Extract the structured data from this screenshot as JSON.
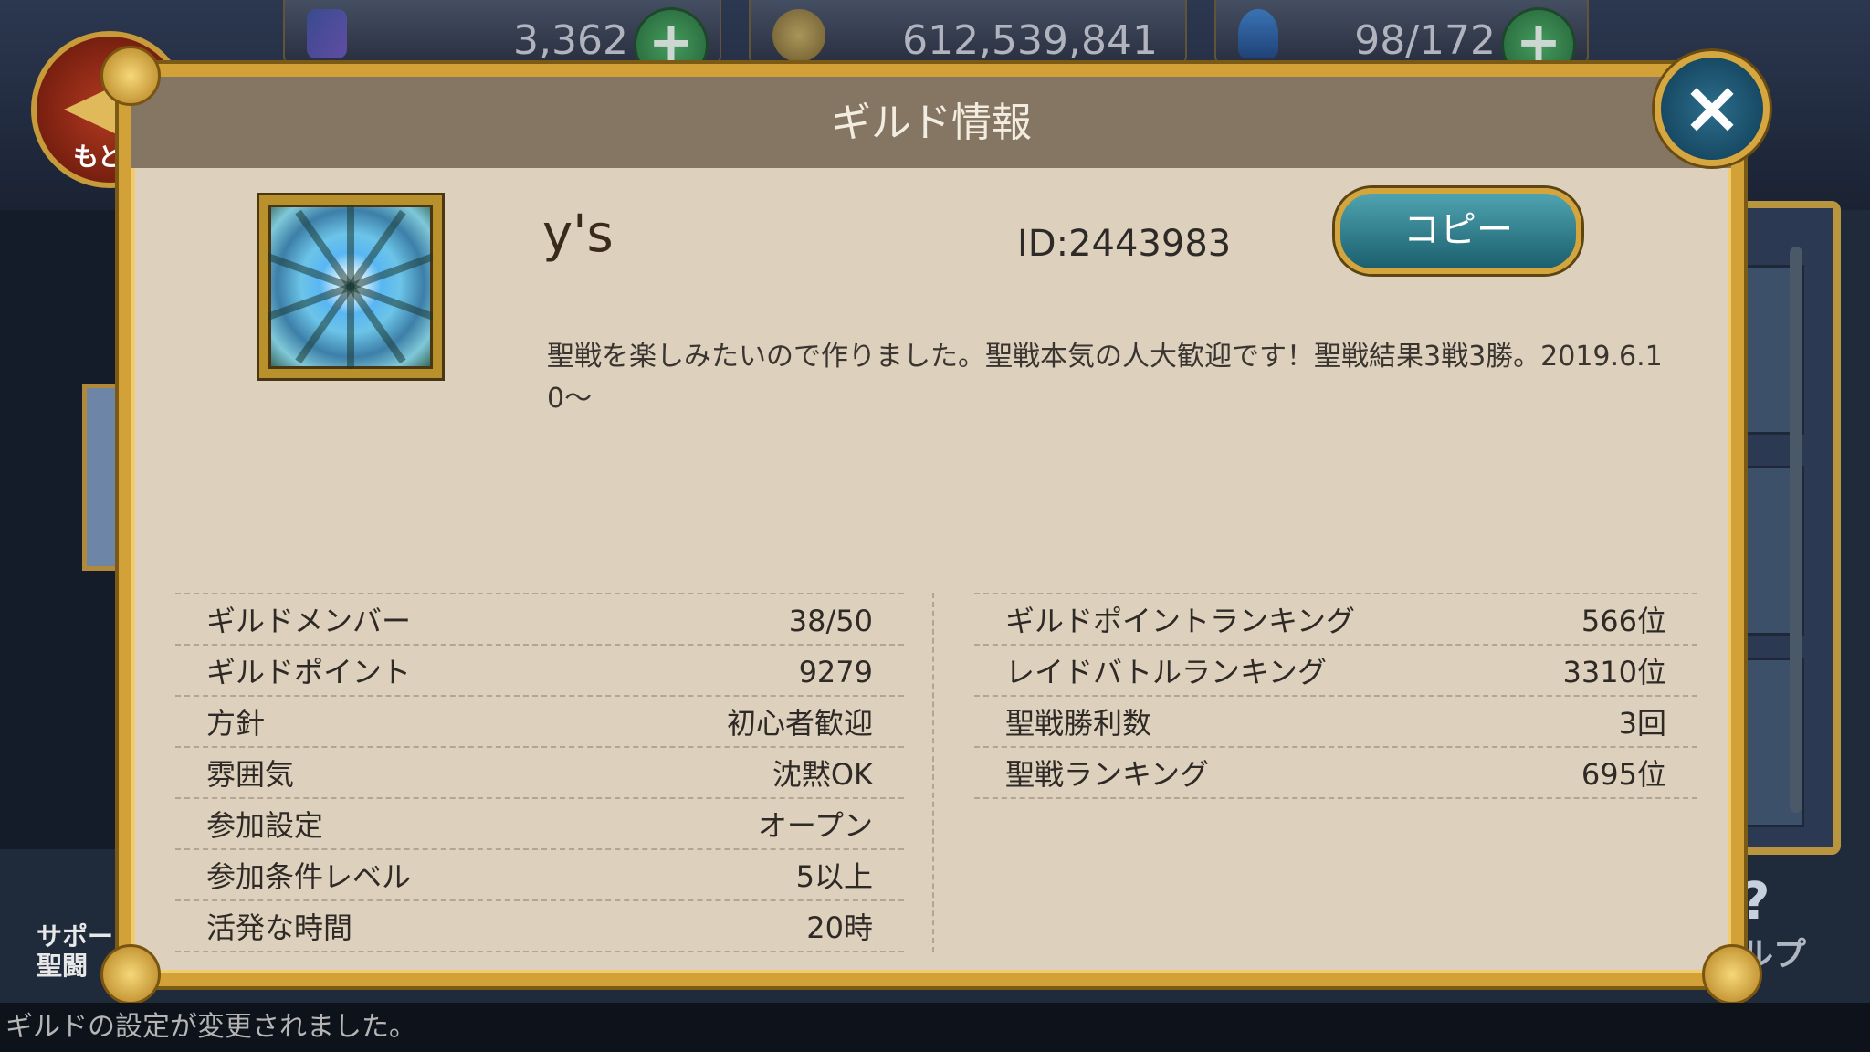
{
  "currencies": [
    {
      "value": "3,362",
      "icon": "crystal-icon"
    },
    {
      "value": "612,539,841",
      "icon": "coin-icon"
    },
    {
      "value": "98/172",
      "icon": "flame-icon"
    }
  ],
  "back_button": {
    "label": "もど"
  },
  "support_button": {
    "label": "サポー\n聖闘"
  },
  "help_button": {
    "label": "ルプ"
  },
  "dialog": {
    "title": "ギルド情報",
    "close_icon": "×"
  },
  "guild": {
    "name": "y's",
    "id": "ID:2443983",
    "copy_label": "コピー",
    "description": "聖戦を楽しみたいので作りました。聖戦本気の人大歓迎です！聖戦結果3戦3勝。2019.6.10〜"
  },
  "stats_left": [
    {
      "label": "ギルドメンバー",
      "value": "38/50"
    },
    {
      "label": "ギルドポイント",
      "value": "9279"
    },
    {
      "label": "方針",
      "value": "初心者歓迎"
    },
    {
      "label": "雰囲気",
      "value": "沈黙OK"
    },
    {
      "label": "参加設定",
      "value": "オープン"
    },
    {
      "label": "参加条件レベル",
      "value": "5以上"
    },
    {
      "label": "活発な時間",
      "value": "20時"
    }
  ],
  "stats_right": [
    {
      "label": "ギルドポイントランキング",
      "value": "566位"
    },
    {
      "label": "レイドバトルランキング",
      "value": "3310位"
    },
    {
      "label": "聖戦勝利数",
      "value": "3回"
    },
    {
      "label": "聖戦ランキング",
      "value": "695位"
    }
  ],
  "status_message": "ギルドの設定が変更されました。",
  "colors": {
    "dialog_bg": "#ddd1bd",
    "header_bg": "#847662",
    "frame_gold": "#d2a238",
    "copy_button": "#2f7f8e",
    "close_button": "#1b5270"
  }
}
